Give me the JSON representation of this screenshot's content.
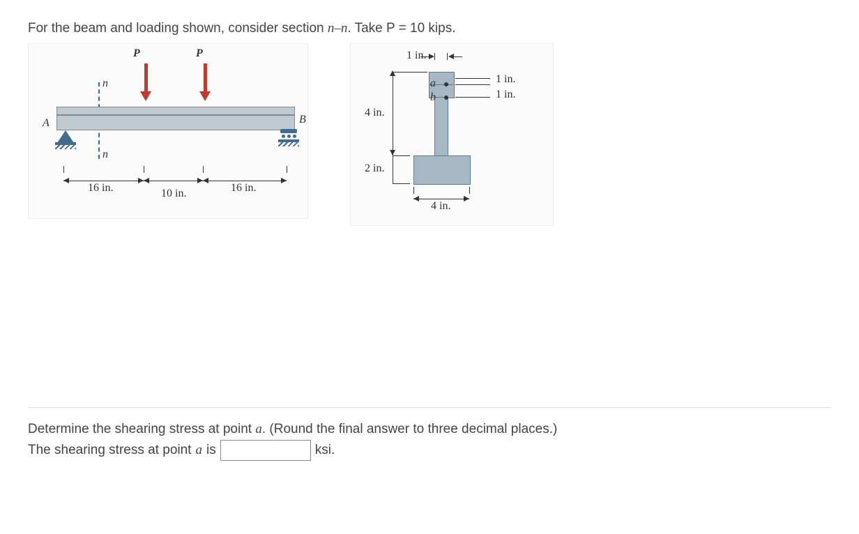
{
  "problem": {
    "text_prefix": "For the beam and loading shown, consider section ",
    "section_label": "n–n",
    "text_mid": ". Take P = ",
    "p_value": "10 kips",
    "text_suffix": "."
  },
  "fig1": {
    "load_label": "P",
    "section_mark": "n",
    "support_left": "A",
    "support_right": "B",
    "dim_left": "16 in.",
    "dim_mid": "10 in.",
    "dim_right": "16 in."
  },
  "fig2": {
    "top_gap": "1 in.",
    "flange_h1": "1 in.",
    "flange_h2": "1 in.",
    "pt_a": "a",
    "pt_b": "b",
    "web_height": "4 in.",
    "base_height": "2 in.",
    "base_width": "4 in."
  },
  "question": {
    "line1_prefix": "Determine the shearing stress at point ",
    "line1_point": "a",
    "line1_suffix": ". (Round the final answer to three decimal places.)",
    "line2_prefix": "The shearing stress at point ",
    "line2_point": "a",
    "line2_mid": " is",
    "unit": "ksi."
  }
}
